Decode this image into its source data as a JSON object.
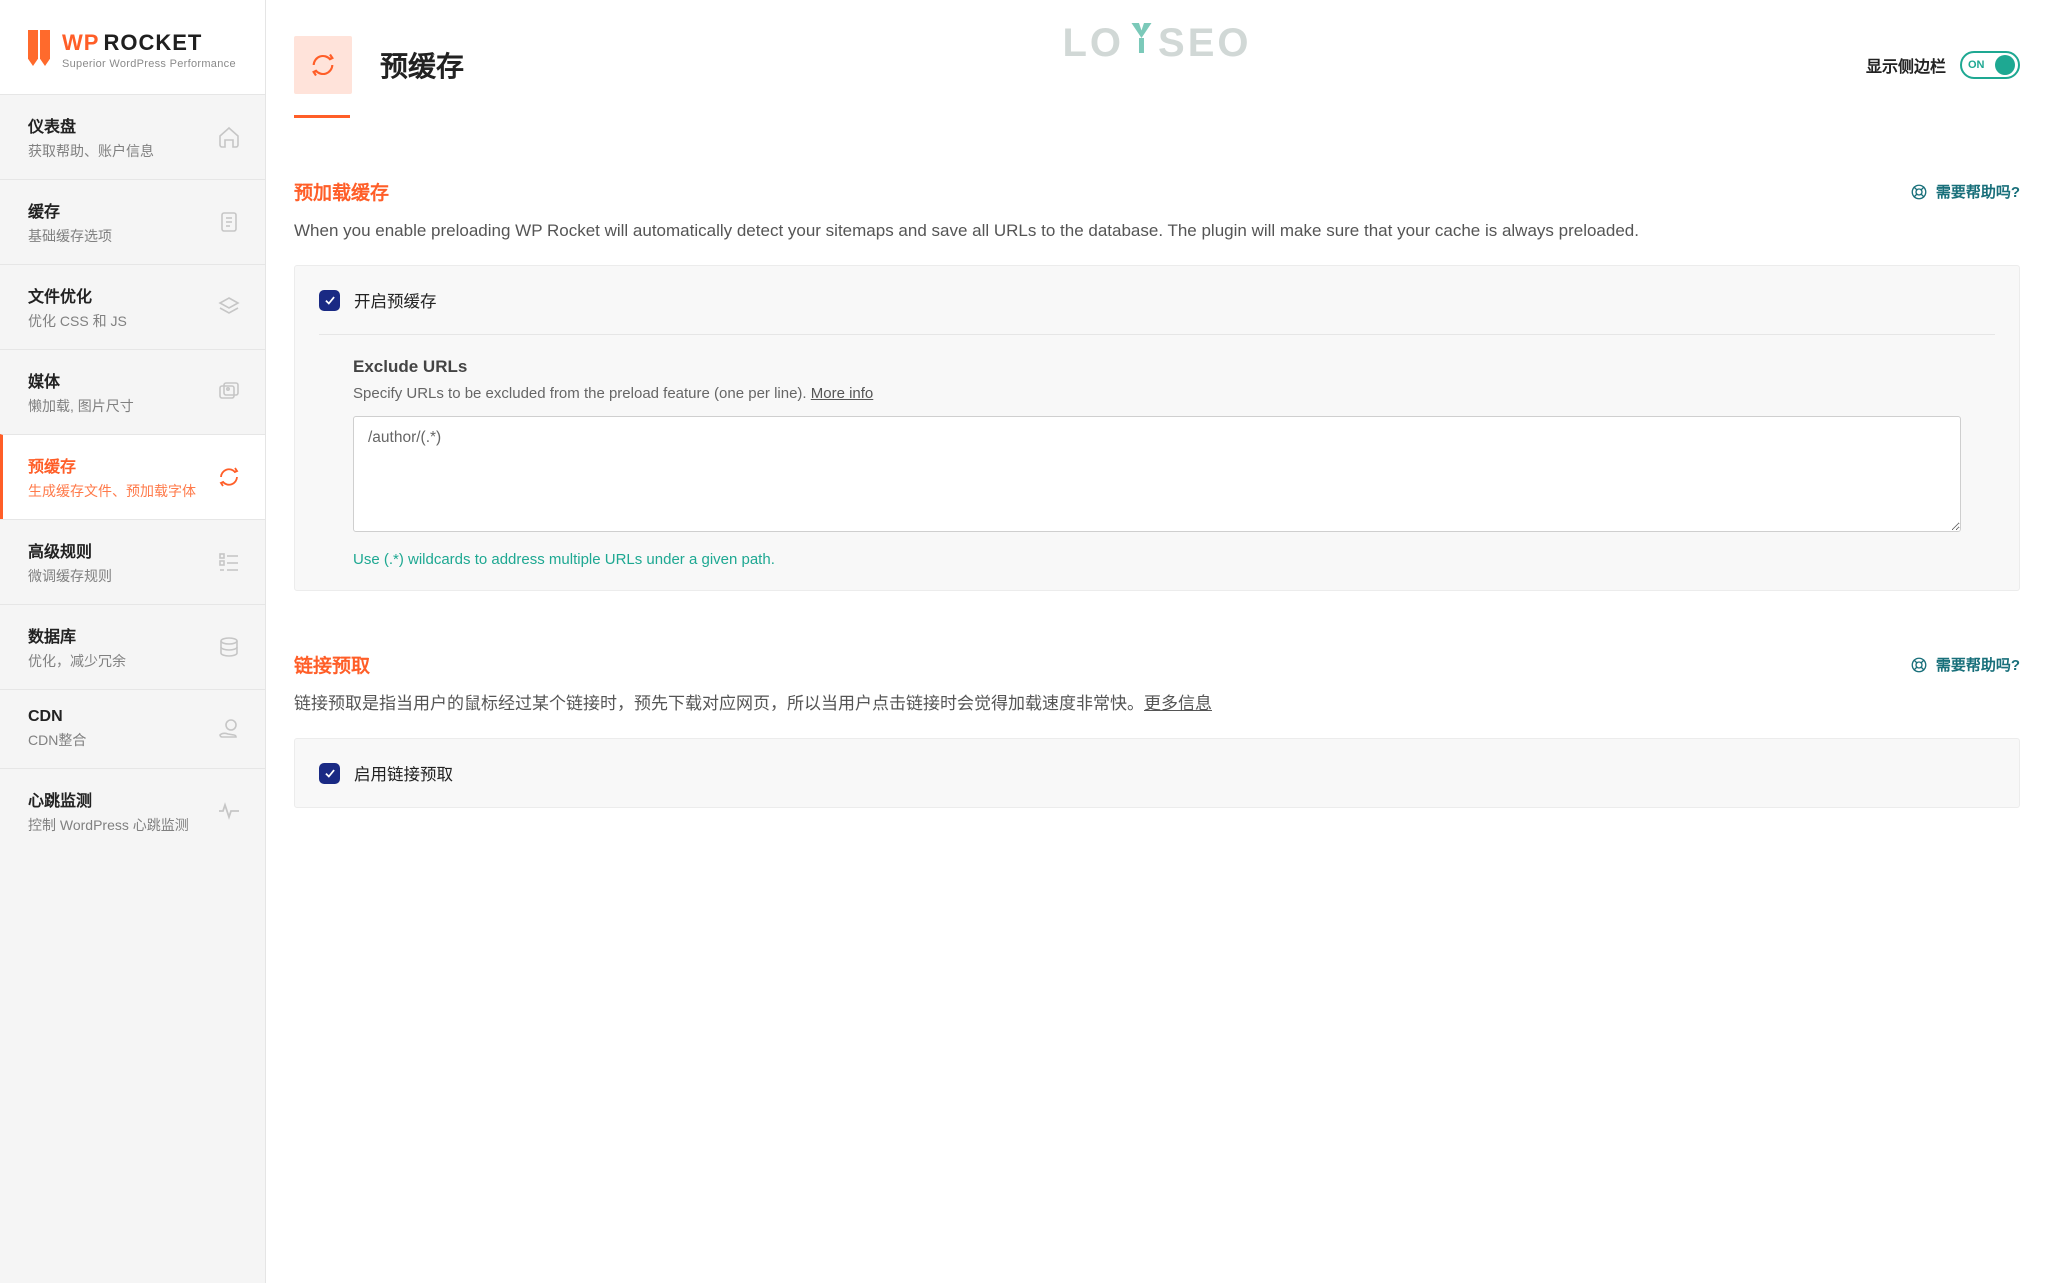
{
  "brand": {
    "wp": "WP",
    "rocket": "ROCKET",
    "sub": "Superior WordPress Performance"
  },
  "watermark": {
    "part1": "LO",
    "y": "Y",
    "part2": "SEO"
  },
  "sidebar": {
    "items": [
      {
        "title": "仪表盘",
        "sub": "获取帮助、账户信息"
      },
      {
        "title": "缓存",
        "sub": "基础缓存选项"
      },
      {
        "title": "文件优化",
        "sub": "优化 CSS 和 JS"
      },
      {
        "title": "媒体",
        "sub": "懒加载, 图片尺寸"
      },
      {
        "title": "预缓存",
        "sub": "生成缓存文件、预加载字体"
      },
      {
        "title": "高级规则",
        "sub": "微调缓存规则"
      },
      {
        "title": "数据库",
        "sub": "优化，减少冗余"
      },
      {
        "title": "CDN",
        "sub": "CDN整合"
      },
      {
        "title": "心跳监测",
        "sub": "控制 WordPress 心跳监测"
      }
    ]
  },
  "page": {
    "title": "预缓存",
    "toggle_label": "显示侧边栏",
    "toggle_on": "ON"
  },
  "preload": {
    "title": "预加载缓存",
    "help": "需要帮助吗?",
    "desc": "When you enable preloading WP Rocket will automatically detect your sitemaps and save all URLs to the database. The plugin will make sure that your cache is always preloaded.",
    "enable_label": "开启预缓存",
    "exclude_title": "Exclude URLs",
    "exclude_sub": "Specify URLs to be excluded from the preload feature (one per line). ",
    "exclude_more": "More info",
    "exclude_value": "/author/(.*)",
    "hint": "Use (.*) wildcards to address multiple URLs under a given path."
  },
  "prefetch": {
    "title": "链接预取",
    "help": "需要帮助吗?",
    "desc": "链接预取是指当用户的鼠标经过某个链接时，预先下载对应网页，所以当用户点击链接时会觉得加载速度非常快。",
    "more": "更多信息",
    "enable_label": "启用链接预取"
  }
}
